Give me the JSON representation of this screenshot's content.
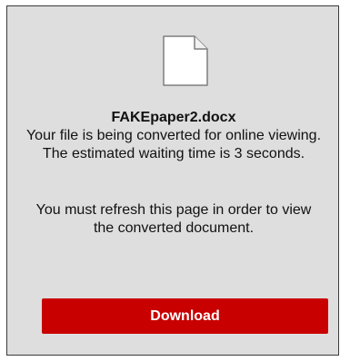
{
  "file_card": {
    "icon": "document-icon",
    "file_name": "FAKEpaper2.docx",
    "conversion_message": "Your file is being converted for online viewing. The estimated waiting time is 3 seconds.",
    "refresh_message": "You must refresh this page in order to view the converted document.",
    "download_label": "Download"
  },
  "colors": {
    "panel_background": "#dedede",
    "panel_border": "#3a3a3a",
    "button_background": "#c90000",
    "button_text": "#ffffff"
  }
}
